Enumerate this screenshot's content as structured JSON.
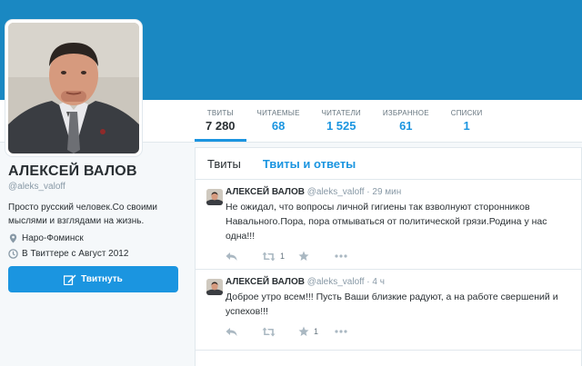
{
  "stats": [
    {
      "label": "ТВИТЫ",
      "value": "7 280",
      "active": true
    },
    {
      "label": "ЧИТАЕМЫЕ",
      "value": "68",
      "active": false
    },
    {
      "label": "ЧИТАТЕЛИ",
      "value": "1 525",
      "active": false
    },
    {
      "label": "ИЗБРАННОЕ",
      "value": "61",
      "active": false
    },
    {
      "label": "СПИСКИ",
      "value": "1",
      "active": false
    }
  ],
  "profile": {
    "name": "АЛЕКСЕЙ ВАЛОВ",
    "handle": "@aleks_valoff",
    "bio": "Просто русский человек.Со своими мыслями и взглядами на жизнь.",
    "location": "Наро-Фоминск",
    "joined": "В Твиттере с Август 2012",
    "tweet_button": "Твитнуть"
  },
  "timeline": {
    "tabs": [
      "Твиты",
      "Твиты и ответы"
    ],
    "tweets": [
      {
        "name": "АЛЕКСЕЙ ВАЛОВ",
        "handle": "@aleks_valoff",
        "time": "· 29 мин",
        "text": "Не ожидал, что вопросы личной гигиены так взволнуют сторонников Навального.Пора, пора отмываться от политической грязи.Родина у нас одна!!!",
        "retweets": "1",
        "favorites": ""
      },
      {
        "name": "АЛЕКСЕЙ ВАЛОВ",
        "handle": "@aleks_valoff",
        "time": "· 4 ч",
        "text": "Доброе утро всем!!! Пусть Ваши близкие радуют, а на работе свершений и успехов!!!",
        "retweets": "",
        "favorites": "1"
      }
    ]
  },
  "colors": {
    "banner": "#1a88c2",
    "accent": "#1b95e0",
    "text": "#292f33",
    "muted": "#8899a6"
  },
  "icons": [
    "location-icon",
    "calendar-icon",
    "compose-icon",
    "reply-icon",
    "retweet-icon",
    "favorite-icon",
    "more-icon"
  ]
}
